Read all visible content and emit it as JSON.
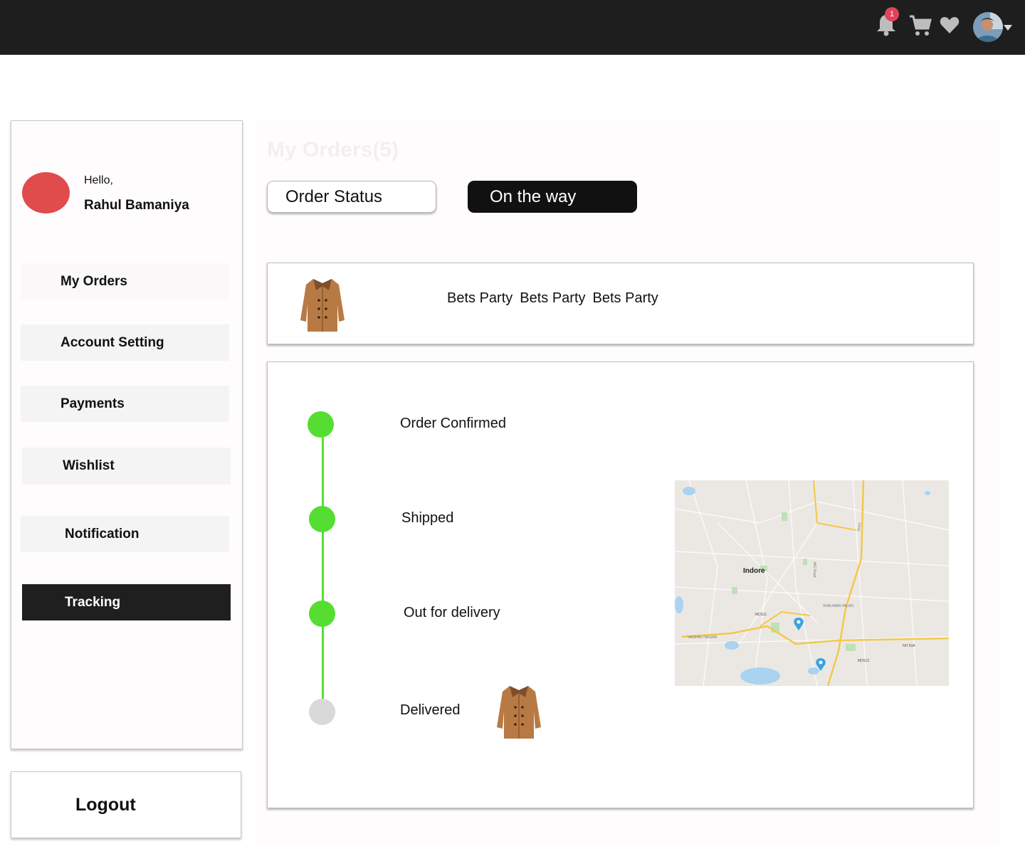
{
  "header": {
    "notification_count": "1",
    "icons": [
      "bell-icon",
      "cart-icon",
      "heart-icon",
      "avatar",
      "chevron-down-icon"
    ]
  },
  "profile": {
    "greeting": "Hello,",
    "name": "Rahul Bamaniya"
  },
  "sidebar": {
    "items": [
      {
        "label": "My Orders"
      },
      {
        "label": "Account Setting"
      },
      {
        "label": "Payments"
      },
      {
        "label": "Wishlist"
      },
      {
        "label": "Notification"
      },
      {
        "label": "Tracking",
        "active": true
      }
    ],
    "logout": "Logout"
  },
  "main": {
    "title": "My Orders(5)",
    "status_label": "Order Status",
    "status_value": "On the way",
    "product": {
      "names": [
        "Bets Party",
        "Bets Party",
        "Bets Party"
      ],
      "image_icon": "coat-icon"
    },
    "tracking": {
      "steps": [
        {
          "label": "Order Confirmed",
          "done": true
        },
        {
          "label": "Shipped",
          "done": true
        },
        {
          "label": "Out for delivery",
          "done": true
        },
        {
          "label": "Delivered",
          "done": false
        }
      ]
    },
    "map": {
      "city": "Indore",
      "labels": [
        "SHALIMAR PALMS",
        "VAISHALI NAGAR",
        "MDS11",
        "MDS21",
        "NH 59A",
        "MG Road",
        "AH47"
      ]
    }
  },
  "colors": {
    "topbar": "#1e1e1e",
    "accent_dark": "#111111",
    "step_done": "#55de31",
    "step_pending": "#d9d9d9",
    "avatar_dot": "#e04b4b",
    "badge": "#e0435a"
  }
}
